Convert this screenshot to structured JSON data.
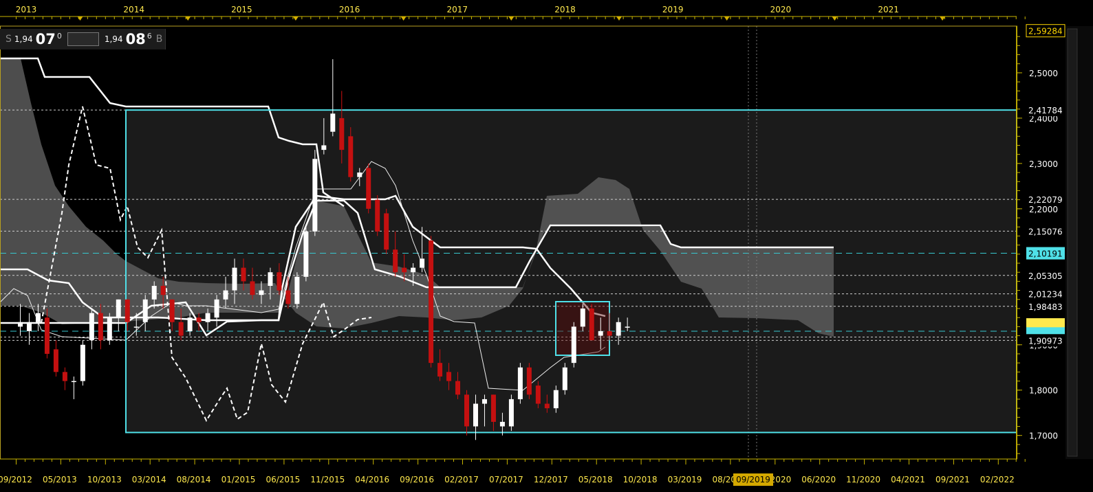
{
  "quote": {
    "bid_side": "S",
    "bid_big": "1,94",
    "bid_bold": "07",
    "bid_sup": "0",
    "ask_big": "1,94",
    "ask_bold": "08",
    "ask_sup": "6",
    "ask_side": "B"
  },
  "chart_data": {
    "type": "candlestick",
    "top_axis_years": [
      "2013",
      "2014",
      "2015",
      "2016",
      "2017",
      "2018",
      "2019",
      "2020",
      "2021"
    ],
    "bottom_axis_labels": [
      "09/2012",
      "05/2013",
      "10/2013",
      "03/2014",
      "08/2014",
      "01/2015",
      "06/2015",
      "11/2015",
      "04/2016",
      "09/2016",
      "02/2017",
      "07/2017",
      "12/2017",
      "05/2018",
      "10/2018",
      "03/2019",
      "08/2019",
      "01/2020",
      "06/2020",
      "11/2020",
      "04/2021",
      "09/2021",
      "02/2022"
    ],
    "cursor_label": "09/2019",
    "y_axis_ticks": [
      "2,5000",
      "2,4000",
      "2,3000",
      "2,2000",
      "1,8000",
      "1,7000",
      "1,9000"
    ],
    "y_axis_ticks_values": [
      2.5,
      2.4,
      2.3,
      2.2,
      1.8,
      1.7,
      1.9
    ],
    "price_labels": [
      {
        "text": "2,59284",
        "value": 2.59284,
        "color": "#ffd700"
      },
      {
        "text": "2,41784",
        "value": 2.41784,
        "color": "#ffffff"
      },
      {
        "text": "2,22079",
        "value": 2.22079,
        "color": "#ffffff"
      },
      {
        "text": "2,15076",
        "value": 2.15076,
        "color": "#ffffff"
      },
      {
        "text": "2,10191",
        "value": 2.10191,
        "color": "#4fe0e8"
      },
      {
        "text": "2,05305",
        "value": 2.05305,
        "color": "#ffffff"
      },
      {
        "text": "2,01234",
        "value": 2.01234,
        "color": "#ffffff"
      },
      {
        "text": "1,98483",
        "value": 1.98483,
        "color": "#ffffff"
      },
      {
        "text": "1,90973",
        "value": 1.90973,
        "color": "#ffffff"
      }
    ],
    "ylim": [
      1.648,
      2.603
    ],
    "candles": [
      {
        "o": 1.94,
        "h": 1.99,
        "l": 1.92,
        "c": 1.95
      },
      {
        "o": 1.93,
        "h": 1.97,
        "l": 1.9,
        "c": 1.95
      },
      {
        "o": 1.95,
        "h": 1.99,
        "l": 1.93,
        "c": 1.97
      },
      {
        "o": 1.96,
        "h": 1.98,
        "l": 1.87,
        "c": 1.88
      },
      {
        "o": 1.89,
        "h": 1.91,
        "l": 1.83,
        "c": 1.84
      },
      {
        "o": 1.84,
        "h": 1.85,
        "l": 1.8,
        "c": 1.82
      },
      {
        "o": 1.82,
        "h": 1.83,
        "l": 1.78,
        "c": 1.82
      },
      {
        "o": 1.82,
        "h": 1.91,
        "l": 1.81,
        "c": 1.9
      },
      {
        "o": 1.91,
        "h": 1.98,
        "l": 1.89,
        "c": 1.97
      },
      {
        "o": 1.97,
        "h": 1.99,
        "l": 1.89,
        "c": 1.91
      },
      {
        "o": 1.91,
        "h": 1.97,
        "l": 1.9,
        "c": 1.96
      },
      {
        "o": 1.96,
        "h": 2.0,
        "l": 1.93,
        "c": 2.0
      },
      {
        "o": 2.0,
        "h": 2.0,
        "l": 1.93,
        "c": 1.95
      },
      {
        "o": 1.94,
        "h": 1.97,
        "l": 1.92,
        "c": 1.94
      },
      {
        "o": 1.95,
        "h": 2.01,
        "l": 1.93,
        "c": 2.0
      },
      {
        "o": 2.0,
        "h": 2.04,
        "l": 1.98,
        "c": 2.03
      },
      {
        "o": 2.03,
        "h": 2.05,
        "l": 1.98,
        "c": 2.01
      },
      {
        "o": 2.0,
        "h": 2.0,
        "l": 1.93,
        "c": 1.95
      },
      {
        "o": 1.95,
        "h": 1.98,
        "l": 1.91,
        "c": 1.92
      },
      {
        "o": 1.93,
        "h": 1.97,
        "l": 1.92,
        "c": 1.96
      },
      {
        "o": 1.96,
        "h": 1.97,
        "l": 1.93,
        "c": 1.95
      },
      {
        "o": 1.95,
        "h": 1.98,
        "l": 1.93,
        "c": 1.97
      },
      {
        "o": 1.96,
        "h": 2.01,
        "l": 1.94,
        "c": 2.0
      },
      {
        "o": 2.0,
        "h": 2.05,
        "l": 1.98,
        "c": 2.02
      },
      {
        "o": 2.02,
        "h": 2.09,
        "l": 1.99,
        "c": 2.07
      },
      {
        "o": 2.07,
        "h": 2.09,
        "l": 2.02,
        "c": 2.04
      },
      {
        "o": 2.04,
        "h": 2.07,
        "l": 2.0,
        "c": 2.01
      },
      {
        "o": 2.01,
        "h": 2.04,
        "l": 1.99,
        "c": 2.02
      },
      {
        "o": 2.03,
        "h": 2.07,
        "l": 2.0,
        "c": 2.06
      },
      {
        "o": 2.06,
        "h": 2.08,
        "l": 2.01,
        "c": 2.02
      },
      {
        "o": 2.02,
        "h": 2.05,
        "l": 1.98,
        "c": 1.99
      },
      {
        "o": 1.99,
        "h": 2.06,
        "l": 1.98,
        "c": 2.05
      },
      {
        "o": 2.05,
        "h": 2.16,
        "l": 2.04,
        "c": 2.15
      },
      {
        "o": 2.15,
        "h": 2.33,
        "l": 2.14,
        "c": 2.31
      },
      {
        "o": 2.33,
        "h": 2.4,
        "l": 2.32,
        "c": 2.34
      },
      {
        "o": 2.37,
        "h": 2.53,
        "l": 2.36,
        "c": 2.41
      },
      {
        "o": 2.4,
        "h": 2.46,
        "l": 2.3,
        "c": 2.33
      },
      {
        "o": 2.36,
        "h": 2.38,
        "l": 2.26,
        "c": 2.27
      },
      {
        "o": 2.27,
        "h": 2.29,
        "l": 2.25,
        "c": 2.28
      },
      {
        "o": 2.29,
        "h": 2.3,
        "l": 2.19,
        "c": 2.2
      },
      {
        "o": 2.22,
        "h": 2.23,
        "l": 2.14,
        "c": 2.15
      },
      {
        "o": 2.19,
        "h": 2.2,
        "l": 2.1,
        "c": 2.11
      },
      {
        "o": 2.11,
        "h": 2.15,
        "l": 2.05,
        "c": 2.06
      },
      {
        "o": 2.07,
        "h": 2.1,
        "l": 2.04,
        "c": 2.06
      },
      {
        "o": 2.06,
        "h": 2.08,
        "l": 2.03,
        "c": 2.07
      },
      {
        "o": 2.07,
        "h": 2.16,
        "l": 2.06,
        "c": 2.09
      },
      {
        "o": 2.13,
        "h": 2.14,
        "l": 1.85,
        "c": 1.86
      },
      {
        "o": 1.86,
        "h": 1.89,
        "l": 1.82,
        "c": 1.83
      },
      {
        "o": 1.84,
        "h": 1.86,
        "l": 1.8,
        "c": 1.82
      },
      {
        "o": 1.82,
        "h": 1.84,
        "l": 1.78,
        "c": 1.79
      },
      {
        "o": 1.79,
        "h": 1.8,
        "l": 1.7,
        "c": 1.72
      },
      {
        "o": 1.72,
        "h": 1.79,
        "l": 1.69,
        "c": 1.77
      },
      {
        "o": 1.77,
        "h": 1.79,
        "l": 1.72,
        "c": 1.78
      },
      {
        "o": 1.79,
        "h": 1.79,
        "l": 1.71,
        "c": 1.73
      },
      {
        "o": 1.72,
        "h": 1.75,
        "l": 1.7,
        "c": 1.73
      },
      {
        "o": 1.72,
        "h": 1.79,
        "l": 1.71,
        "c": 1.78
      },
      {
        "o": 1.78,
        "h": 1.86,
        "l": 1.77,
        "c": 1.85
      },
      {
        "o": 1.85,
        "h": 1.86,
        "l": 1.78,
        "c": 1.79
      },
      {
        "o": 1.81,
        "h": 1.82,
        "l": 1.76,
        "c": 1.77
      },
      {
        "o": 1.77,
        "h": 1.79,
        "l": 1.75,
        "c": 1.76
      },
      {
        "o": 1.76,
        "h": 1.81,
        "l": 1.75,
        "c": 1.8
      },
      {
        "o": 1.8,
        "h": 1.86,
        "l": 1.79,
        "c": 1.85
      },
      {
        "o": 1.86,
        "h": 1.95,
        "l": 1.85,
        "c": 1.94
      },
      {
        "o": 1.94,
        "h": 1.99,
        "l": 1.93,
        "c": 1.98
      },
      {
        "o": 1.98,
        "h": 1.99,
        "l": 1.91,
        "c": 1.91
      },
      {
        "o": 1.92,
        "h": 1.96,
        "l": 1.89,
        "c": 1.93
      },
      {
        "o": 1.93,
        "h": 1.97,
        "l": 1.91,
        "c": 1.92
      },
      {
        "o": 1.92,
        "h": 1.96,
        "l": 1.9,
        "c": 1.95
      },
      {
        "o": 1.94,
        "h": 1.96,
        "l": 1.93,
        "c": 1.94
      }
    ]
  }
}
